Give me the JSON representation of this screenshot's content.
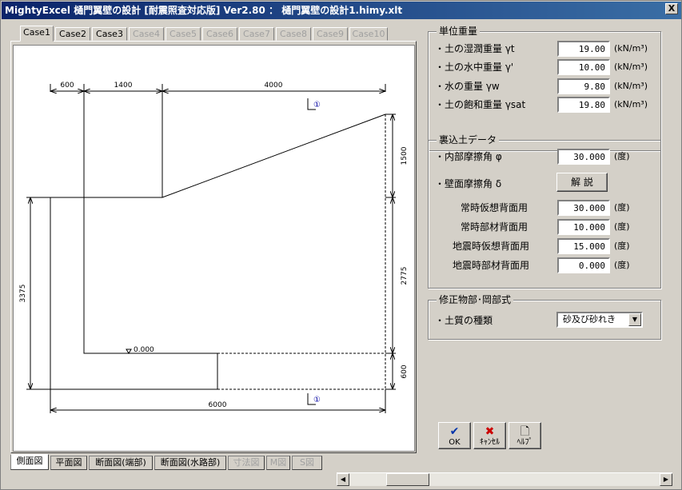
{
  "window": {
    "title": "MightyExcel 樋門翼壁の設計 [耐震照査対応版] Ver2.80 ： 樋門翼壁の設計1.himy.xlt",
    "close_label": "X"
  },
  "case_tabs": [
    "Case1",
    "Case2",
    "Case3",
    "Case4",
    "Case5",
    "Case6",
    "Case7",
    "Case8",
    "Case9",
    "Case10"
  ],
  "case_tabs_enabled": 3,
  "drawing": {
    "dims": {
      "d600a": "600",
      "d1400": "1400",
      "d4000": "4000",
      "d1500": "1500",
      "d3375": "3375",
      "d2775": "2775",
      "d600b": "600",
      "d6000": "6000"
    },
    "level_label": "0.000",
    "section_mark": "①"
  },
  "sheet_tabs": [
    "側面図",
    "平面図",
    "断面図(端部)",
    "断面図(水路部)",
    "寸法図",
    "M図",
    "S図"
  ],
  "unit_weight": {
    "title": "単位重量",
    "rows": [
      {
        "label": "・土の湿潤重量 γt",
        "value": "19.00",
        "unit": "(kN/m³)"
      },
      {
        "label": "・土の水中重量 γ'",
        "value": "10.00",
        "unit": "(kN/m³)"
      },
      {
        "label": "・水の重量      γw",
        "value": "9.80",
        "unit": "(kN/m³)"
      },
      {
        "label": "・土の飽和重量 γsat",
        "value": "19.80",
        "unit": "(kN/m³)"
      }
    ]
  },
  "backfill": {
    "title": "裏込土データ",
    "friction_label": "・内部摩擦角 φ",
    "friction_value": "30.000",
    "friction_unit": "(度)",
    "wall_friction_label": "・壁面摩擦角 δ",
    "explain_button": "解 説",
    "rows": [
      {
        "label": "常時仮想背面用",
        "value": "30.000",
        "unit": "(度)"
      },
      {
        "label": "常時部材背面用",
        "value": "10.000",
        "unit": "(度)"
      },
      {
        "label": "地震時仮想背面用",
        "value": "15.000",
        "unit": "(度)"
      },
      {
        "label": "地震時部材背面用",
        "value": "0.000",
        "unit": "(度)"
      }
    ]
  },
  "mononobe": {
    "title": "修正物部･岡部式",
    "soil_label": "・土質の種類",
    "soil_value": "砂及び砂れき"
  },
  "buttons": {
    "ok": "OK",
    "cancel": "ｷｬﾝｾﾙ",
    "help": "ﾍﾙﾌﾟ"
  }
}
